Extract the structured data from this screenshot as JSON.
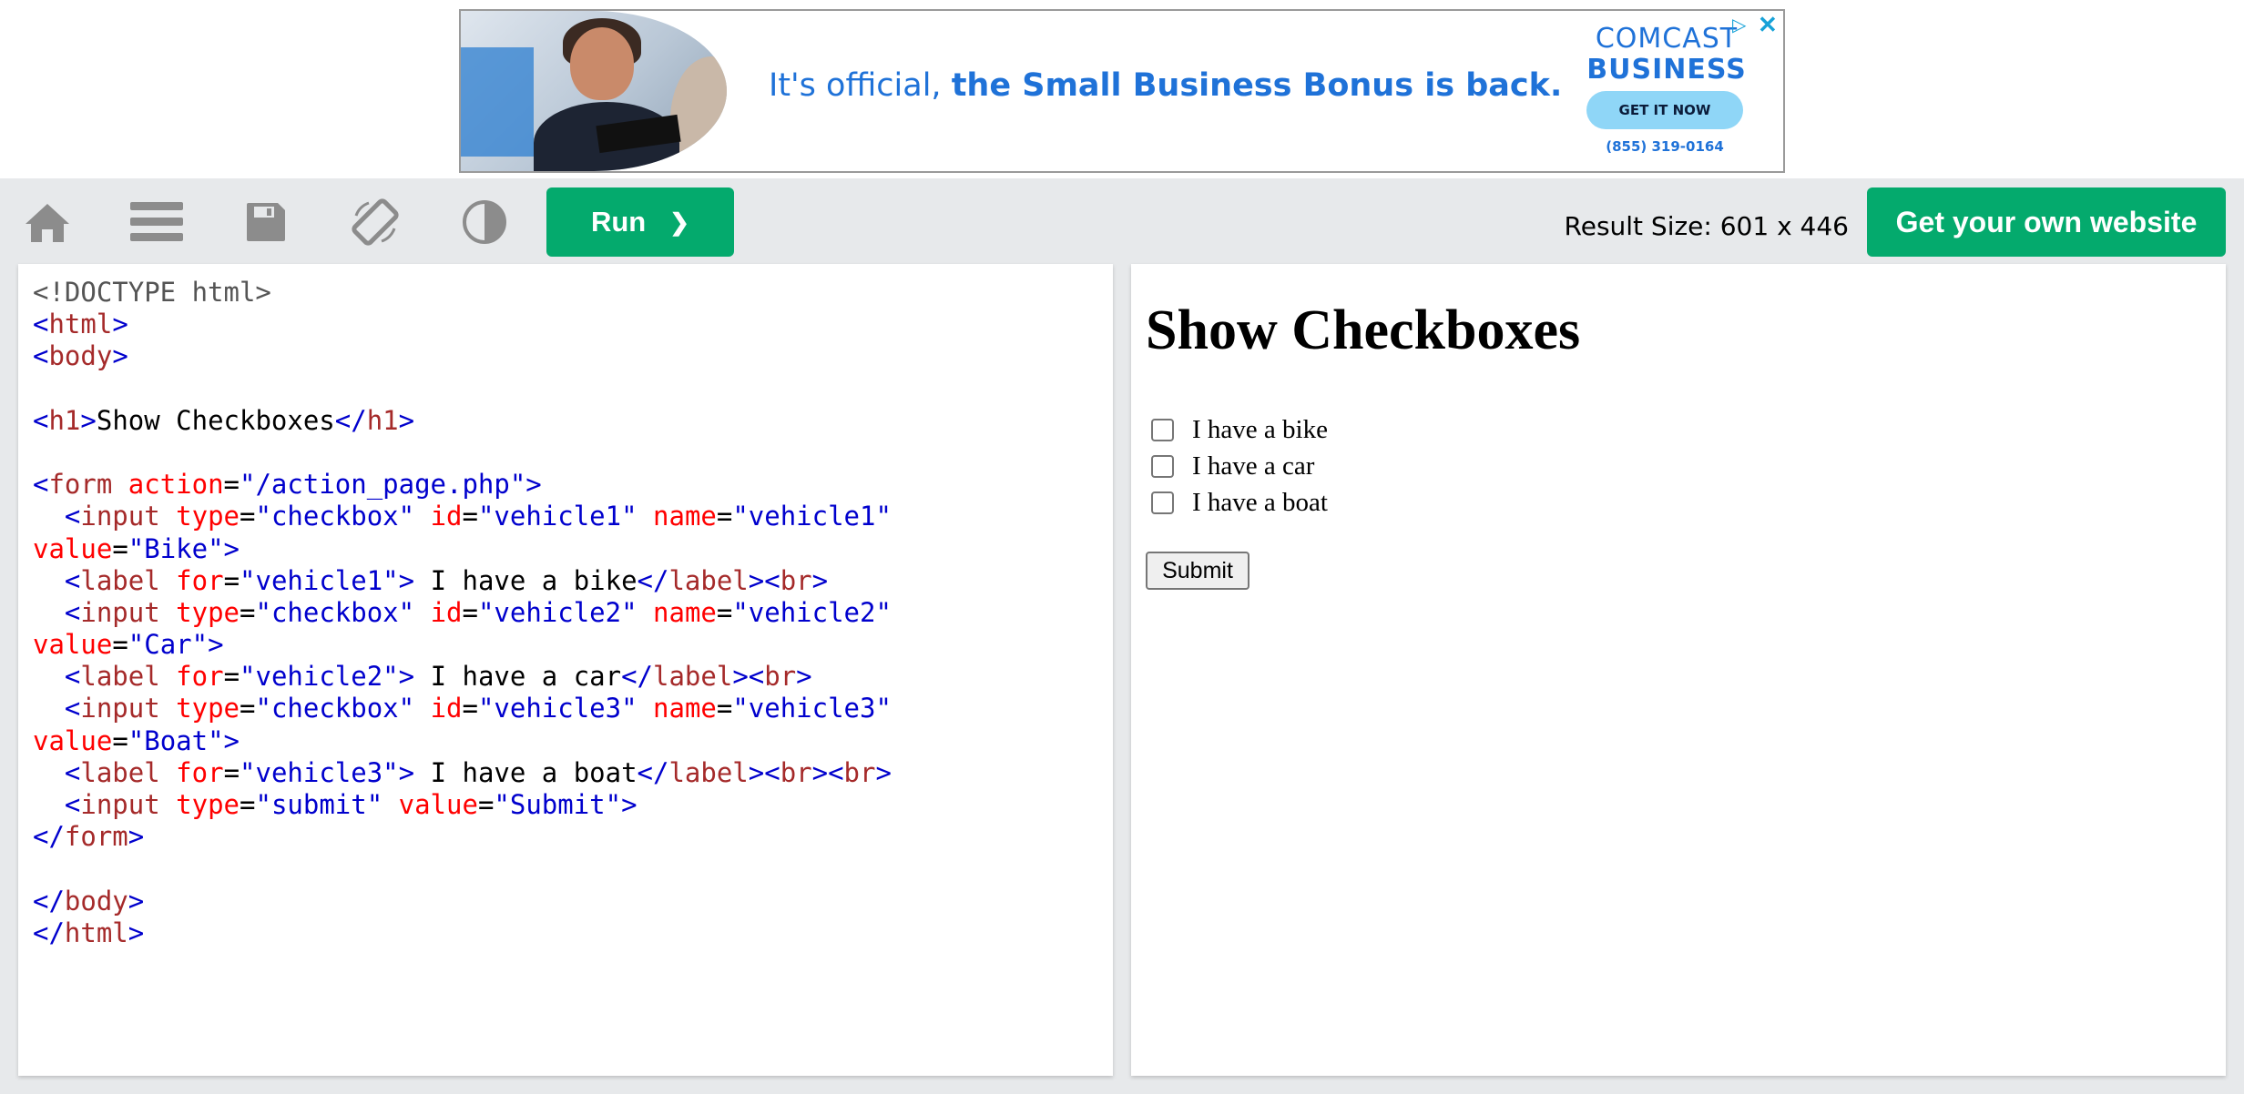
{
  "ad": {
    "text_plain": "It's official,",
    "text_bold": "the Small Business Bonus is back.",
    "brand_line1": "COMCAST",
    "brand_line2": "BUSINESS",
    "cta": "GET IT NOW",
    "phone": "(855) 319-0164",
    "adchoices_glyph": "▷",
    "close_glyph": "✕"
  },
  "toolbar": {
    "icons": [
      "home-icon",
      "menu-icon",
      "save-icon",
      "rotate-icon",
      "contrast-icon"
    ],
    "run_label": "Run",
    "run_glyph": "❯",
    "result_size_label": "Result Size: 601 x 446",
    "get_website_label": "Get your own website"
  },
  "editor": {
    "lines": [
      [
        [
          "doctype",
          "<!DOCTYPE html>"
        ]
      ],
      [
        [
          "br",
          "<"
        ],
        [
          "tag",
          "html"
        ],
        [
          "br",
          ">"
        ]
      ],
      [
        [
          "br",
          "<"
        ],
        [
          "tag",
          "body"
        ],
        [
          "br",
          ">"
        ]
      ],
      [],
      [
        [
          "br",
          "<"
        ],
        [
          "tag",
          "h1"
        ],
        [
          "br",
          ">"
        ],
        [
          "text",
          "Show Checkboxes"
        ],
        [
          "br",
          "</"
        ],
        [
          "tag",
          "h1"
        ],
        [
          "br",
          ">"
        ]
      ],
      [],
      [
        [
          "br",
          "<"
        ],
        [
          "tag",
          "form"
        ],
        [
          "text",
          " "
        ],
        [
          "attr",
          "action"
        ],
        [
          "text",
          "="
        ],
        [
          "val",
          "\"/action_page.php\""
        ],
        [
          "br",
          ">"
        ]
      ],
      [
        [
          "text",
          "  "
        ],
        [
          "br",
          "<"
        ],
        [
          "tag",
          "input"
        ],
        [
          "text",
          " "
        ],
        [
          "attr",
          "type"
        ],
        [
          "text",
          "="
        ],
        [
          "val",
          "\"checkbox\""
        ],
        [
          "text",
          " "
        ],
        [
          "attr",
          "id"
        ],
        [
          "text",
          "="
        ],
        [
          "val",
          "\"vehicle1\""
        ],
        [
          "text",
          " "
        ],
        [
          "attr",
          "name"
        ],
        [
          "text",
          "="
        ],
        [
          "val",
          "\"vehicle1\""
        ]
      ],
      [
        [
          "attr",
          "value"
        ],
        [
          "text",
          "="
        ],
        [
          "val",
          "\"Bike\""
        ],
        [
          "br",
          ">"
        ]
      ],
      [
        [
          "text",
          "  "
        ],
        [
          "br",
          "<"
        ],
        [
          "tag",
          "label"
        ],
        [
          "text",
          " "
        ],
        [
          "attr",
          "for"
        ],
        [
          "text",
          "="
        ],
        [
          "val",
          "\"vehicle1\""
        ],
        [
          "br",
          ">"
        ],
        [
          "text",
          " I have a bike"
        ],
        [
          "br",
          "</"
        ],
        [
          "tag",
          "label"
        ],
        [
          "br",
          "><"
        ],
        [
          "tag",
          "br"
        ],
        [
          "br",
          ">"
        ]
      ],
      [
        [
          "text",
          "  "
        ],
        [
          "br",
          "<"
        ],
        [
          "tag",
          "input"
        ],
        [
          "text",
          " "
        ],
        [
          "attr",
          "type"
        ],
        [
          "text",
          "="
        ],
        [
          "val",
          "\"checkbox\""
        ],
        [
          "text",
          " "
        ],
        [
          "attr",
          "id"
        ],
        [
          "text",
          "="
        ],
        [
          "val",
          "\"vehicle2\""
        ],
        [
          "text",
          " "
        ],
        [
          "attr",
          "name"
        ],
        [
          "text",
          "="
        ],
        [
          "val",
          "\"vehicle2\""
        ]
      ],
      [
        [
          "attr",
          "value"
        ],
        [
          "text",
          "="
        ],
        [
          "val",
          "\"Car\""
        ],
        [
          "br",
          ">"
        ]
      ],
      [
        [
          "text",
          "  "
        ],
        [
          "br",
          "<"
        ],
        [
          "tag",
          "label"
        ],
        [
          "text",
          " "
        ],
        [
          "attr",
          "for"
        ],
        [
          "text",
          "="
        ],
        [
          "val",
          "\"vehicle2\""
        ],
        [
          "br",
          ">"
        ],
        [
          "text",
          " I have a car"
        ],
        [
          "br",
          "</"
        ],
        [
          "tag",
          "label"
        ],
        [
          "br",
          "><"
        ],
        [
          "tag",
          "br"
        ],
        [
          "br",
          ">"
        ]
      ],
      [
        [
          "text",
          "  "
        ],
        [
          "br",
          "<"
        ],
        [
          "tag",
          "input"
        ],
        [
          "text",
          " "
        ],
        [
          "attr",
          "type"
        ],
        [
          "text",
          "="
        ],
        [
          "val",
          "\"checkbox\""
        ],
        [
          "text",
          " "
        ],
        [
          "attr",
          "id"
        ],
        [
          "text",
          "="
        ],
        [
          "val",
          "\"vehicle3\""
        ],
        [
          "text",
          " "
        ],
        [
          "attr",
          "name"
        ],
        [
          "text",
          "="
        ],
        [
          "val",
          "\"vehicle3\""
        ]
      ],
      [
        [
          "attr",
          "value"
        ],
        [
          "text",
          "="
        ],
        [
          "val",
          "\"Boat\""
        ],
        [
          "br",
          ">"
        ]
      ],
      [
        [
          "text",
          "  "
        ],
        [
          "br",
          "<"
        ],
        [
          "tag",
          "label"
        ],
        [
          "text",
          " "
        ],
        [
          "attr",
          "for"
        ],
        [
          "text",
          "="
        ],
        [
          "val",
          "\"vehicle3\""
        ],
        [
          "br",
          ">"
        ],
        [
          "text",
          " I have a boat"
        ],
        [
          "br",
          "</"
        ],
        [
          "tag",
          "label"
        ],
        [
          "br",
          "><"
        ],
        [
          "tag",
          "br"
        ],
        [
          "br",
          "><"
        ],
        [
          "tag",
          "br"
        ],
        [
          "br",
          ">"
        ]
      ],
      [
        [
          "text",
          "  "
        ],
        [
          "br",
          "<"
        ],
        [
          "tag",
          "input"
        ],
        [
          "text",
          " "
        ],
        [
          "attr",
          "type"
        ],
        [
          "text",
          "="
        ],
        [
          "val",
          "\"submit\""
        ],
        [
          "text",
          " "
        ],
        [
          "attr",
          "value"
        ],
        [
          "text",
          "="
        ],
        [
          "val",
          "\"Submit\""
        ],
        [
          "br",
          ">"
        ]
      ],
      [
        [
          "br",
          "</"
        ],
        [
          "tag",
          "form"
        ],
        [
          "br",
          ">"
        ]
      ],
      [],
      [
        [
          "br",
          "</"
        ],
        [
          "tag",
          "body"
        ],
        [
          "br",
          ">"
        ]
      ],
      [
        [
          "br",
          "</"
        ],
        [
          "tag",
          "html"
        ],
        [
          "br",
          ">"
        ]
      ]
    ]
  },
  "result": {
    "heading": "Show Checkboxes",
    "checkboxes": [
      {
        "label": "I have a bike",
        "checked": false
      },
      {
        "label": "I have a car",
        "checked": false
      },
      {
        "label": "I have a boat",
        "checked": false
      }
    ],
    "submit_label": "Submit"
  },
  "colors": {
    "accent_green": "#04aa6d",
    "toolbar_bg": "#e7e9eb",
    "tag": "#a52a2a",
    "bracket": "#0000cd",
    "attribute": "#ff0000",
    "value": "#0000cd",
    "ad_blue": "#1f72d8"
  }
}
